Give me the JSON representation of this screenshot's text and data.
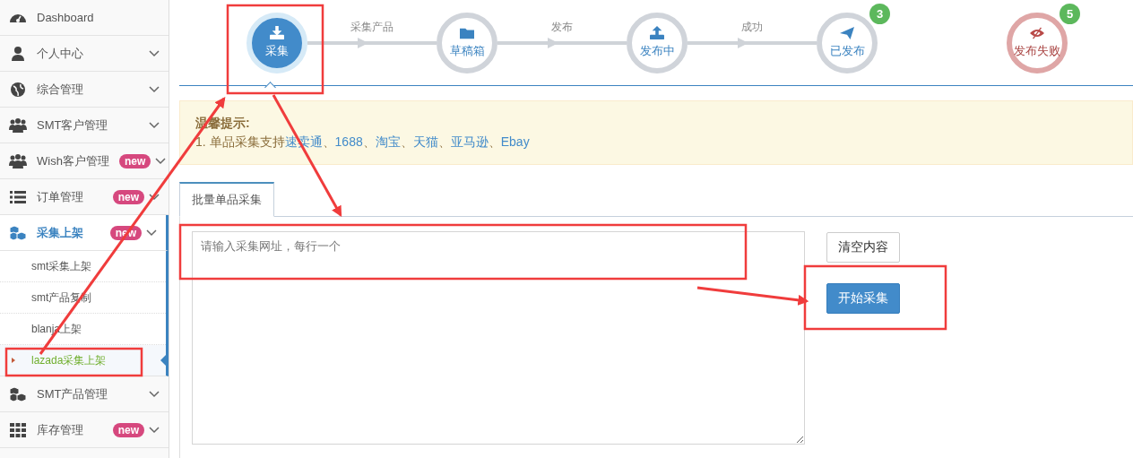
{
  "sidebar": {
    "items": [
      {
        "label": "Dashboard",
        "chevron": false,
        "selected": false
      },
      {
        "label": "个人中心",
        "chevron": true,
        "selected": false
      },
      {
        "label": "综合管理",
        "chevron": true,
        "selected": false
      },
      {
        "label": "SMT客户管理",
        "chevron": true,
        "selected": false
      },
      {
        "label": "Wish客户管理",
        "badge": "new",
        "chevron": true,
        "selected": false
      },
      {
        "label": "订单管理",
        "badge": "new",
        "chevron": true,
        "selected": false
      },
      {
        "label": "采集上架",
        "badge": "new",
        "chevron": true,
        "selected": true,
        "children": [
          {
            "label": "smt采集上架",
            "selected": false
          },
          {
            "label": "smt产品复制",
            "selected": false
          },
          {
            "label": "blanja上架",
            "selected": false
          },
          {
            "label": "lazada采集上架",
            "selected": true
          }
        ]
      },
      {
        "label": "SMT产品管理",
        "chevron": true,
        "selected": false
      },
      {
        "label": "库存管理",
        "badge": "new",
        "chevron": true,
        "selected": false
      }
    ]
  },
  "steps": [
    {
      "label": "采集",
      "kind": "current"
    },
    {
      "label": "草稿箱",
      "kind": "normal",
      "arrow_label": "采集产品"
    },
    {
      "label": "发布中",
      "kind": "normal",
      "arrow_label": "发布"
    },
    {
      "label": "已发布",
      "kind": "normal",
      "arrow_label": "成功",
      "badge": "3"
    },
    {
      "label": "发布失败",
      "kind": "failed",
      "badge": "5"
    }
  ],
  "tip": {
    "title": "温馨提示:",
    "parts": [
      {
        "text": "1.  单品采集支持",
        "kind": "text"
      },
      {
        "text": "速卖通",
        "kind": "link"
      },
      {
        "text": "、",
        "kind": "text"
      },
      {
        "text": "1688",
        "kind": "link"
      },
      {
        "text": "、",
        "kind": "text"
      },
      {
        "text": "淘宝",
        "kind": "link"
      },
      {
        "text": "、",
        "kind": "text"
      },
      {
        "text": "天猫",
        "kind": "link"
      },
      {
        "text": "、",
        "kind": "text"
      },
      {
        "text": "亚马逊",
        "kind": "link"
      },
      {
        "text": "、",
        "kind": "text"
      },
      {
        "text": "Ebay",
        "kind": "link"
      }
    ]
  },
  "tabs": [
    {
      "label": "批量单品采集",
      "selected": true
    }
  ],
  "url_input": {
    "placeholder": "请输入采集网址，每行一个"
  },
  "buttons": [
    {
      "label": "清空内容",
      "kind": "default"
    },
    {
      "label": "开始采集",
      "kind": "primary"
    }
  ]
}
